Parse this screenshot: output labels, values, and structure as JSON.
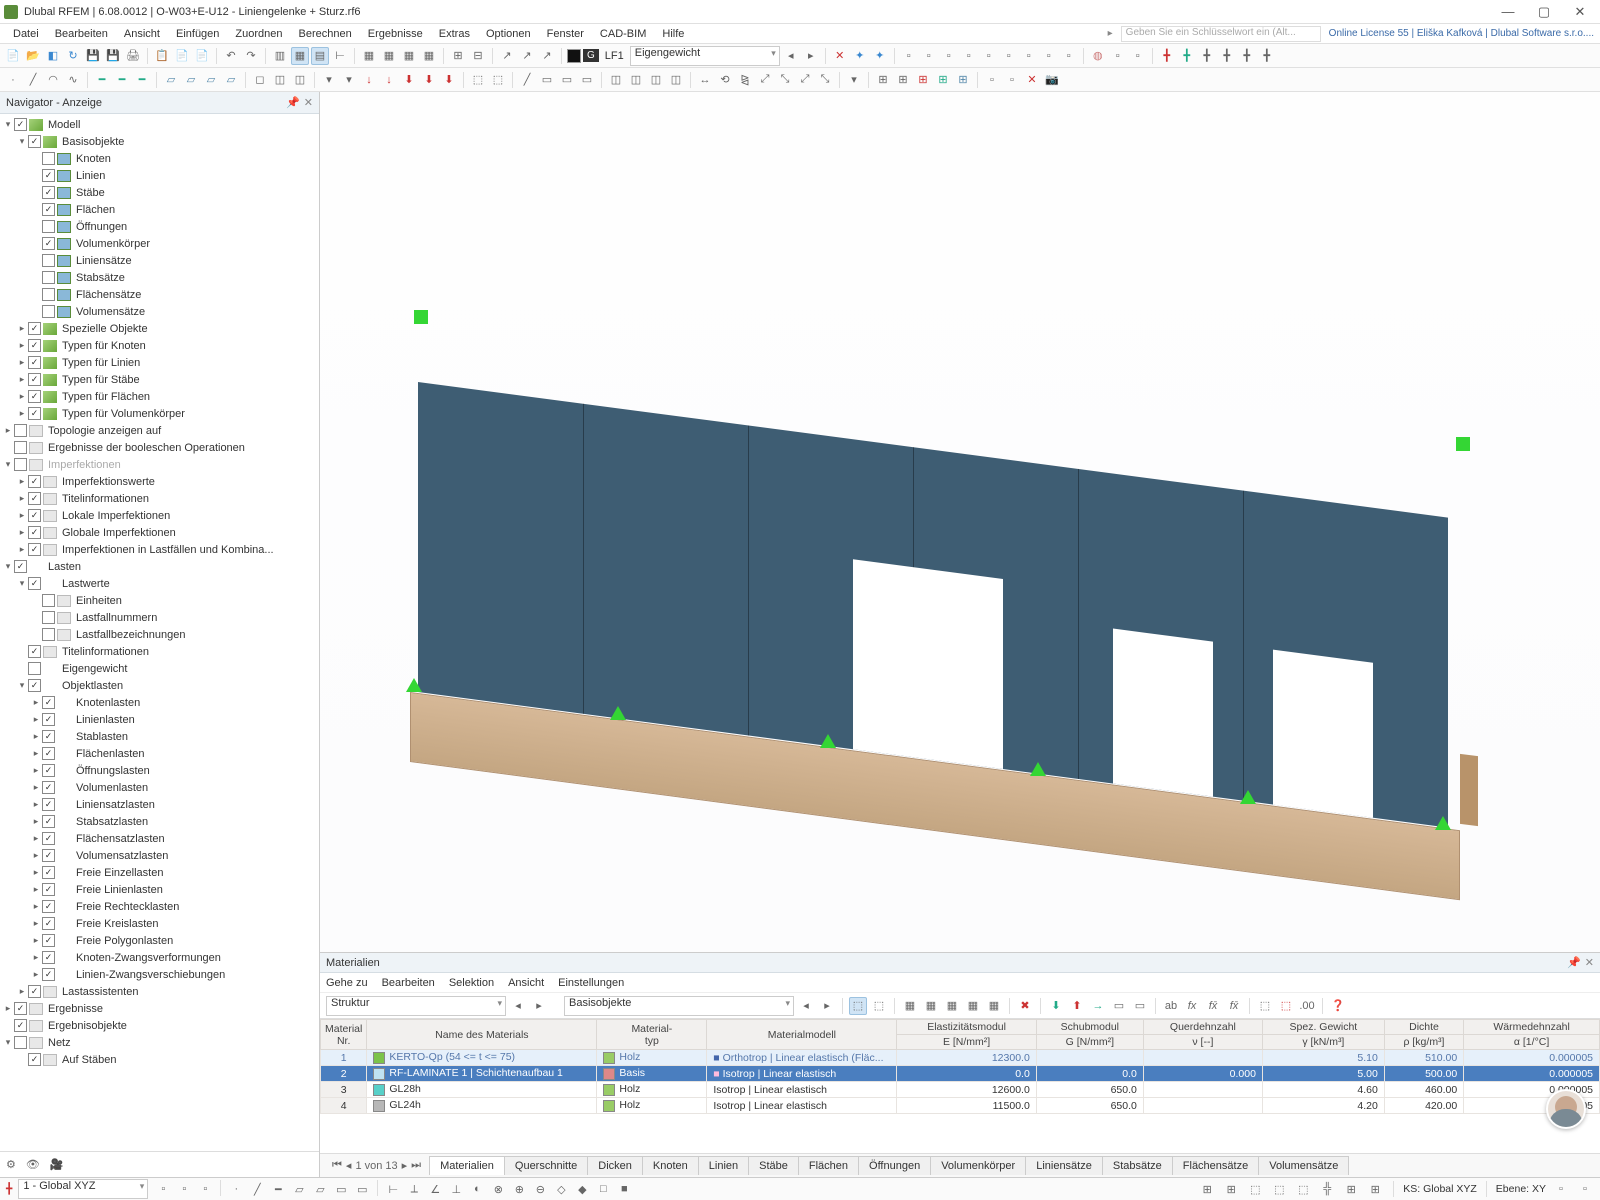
{
  "title": "Dlubal RFEM | 6.08.0012 | O-W03+E-U12 - Liniengelenke + Sturz.rf6",
  "menu": [
    "Datei",
    "Bearbeiten",
    "Ansicht",
    "Einfügen",
    "Zuordnen",
    "Berechnen",
    "Ergebnisse",
    "Extras",
    "Optionen",
    "Fenster",
    "CAD-BIM",
    "Hilfe"
  ],
  "search_ph": "Geben Sie ein Schlüsselwort ein (Alt...",
  "license": "Online License 55 | Eliška Kafková | Dlubal Software s.r.o....",
  "lf_code": "LF1",
  "lf_name": "Eigengewicht",
  "nav_title": "Navigator - Anzeige",
  "tree": {
    "model": "Modell",
    "basis": "Basisobjekte",
    "items1": [
      "Knoten",
      "Linien",
      "Stäbe",
      "Flächen",
      "Öffnungen",
      "Volumenkörper",
      "Liniensätze",
      "Stabsätze",
      "Flächensätze",
      "Volumensätze"
    ],
    "chk1": [
      false,
      true,
      true,
      true,
      false,
      true,
      false,
      false,
      false,
      false
    ],
    "spez": "Spezielle Objekte",
    "typen": [
      "Typen für Knoten",
      "Typen für Linien",
      "Typen für Stäbe",
      "Typen für Flächen",
      "Typen für Volumenkörper"
    ],
    "topo": "Topologie anzeigen auf",
    "boole": "Ergebnisse der booleschen Operationen",
    "imp": "Imperfektionen",
    "imps": [
      "Imperfektionswerte",
      "Titelinformationen",
      "Lokale Imperfektionen",
      "Globale Imperfektionen",
      "Imperfektionen in Lastfällen und Kombina..."
    ],
    "lasten": "Lasten",
    "lastwerte": "Lastwerte",
    "lv": [
      "Einheiten",
      "Lastfallnummern",
      "Lastfallbezeichnungen"
    ],
    "titel": "Titelinformationen",
    "eigen": "Eigengewicht",
    "objlast": "Objektlasten",
    "ol": [
      "Knotenlasten",
      "Linienlasten",
      "Stablasten",
      "Flächenlasten",
      "Öffnungslasten",
      "Volumenlasten",
      "Liniensatzlasten",
      "Stabsatzlasten",
      "Flächensatzlasten",
      "Volumensatzlasten",
      "Freie Einzellasten",
      "Freie Linienlasten",
      "Freie Rechtecklasten",
      "Freie Kreislasten",
      "Freie Polygonlasten",
      "Knoten-Zwangsverformungen",
      "Linien-Zwangsverschiebungen"
    ],
    "la": "Lastassistenten",
    "erg": "Ergebnisse",
    "ergobj": "Ergebnisobjekte",
    "netz": "Netz",
    "aufstab": "Auf Stäben"
  },
  "bp": {
    "title": "Materialien",
    "menu": [
      "Gehe zu",
      "Bearbeiten",
      "Selektion",
      "Ansicht",
      "Einstellungen"
    ],
    "dd1": "Struktur",
    "dd2": "Basisobjekte",
    "cols": {
      "nr1": "Material",
      "nr2": "Nr.",
      "name": "Name des Materials",
      "typ1": "Material-",
      "typ2": "typ",
      "modell": "Materialmodell",
      "e1": "Elastizitätsmodul",
      "e2": "E [N/mm²]",
      "g1": "Schubmodul",
      "g2": "G [N/mm²]",
      "v1": "Querdehnzahl",
      "v2": "ν [--]",
      "s1": "Spez. Gewicht",
      "s2": "γ [kN/m³]",
      "d1": "Dichte",
      "d2": "ρ [kg/m³]",
      "w1": "Wärmedehnzahl",
      "w2": "α [1/°C]"
    },
    "rows": [
      {
        "n": "1",
        "name": "KERTO-Qp (54 <= t <= 75)",
        "sw": "#7cc34a",
        "typ": "Holz",
        "mm": "Orthotrop | Linear elastisch (Fläc...",
        "e": "12300.0",
        "g": "",
        "v": "",
        "s": "5.10",
        "d": "510.00",
        "w": "0.000005"
      },
      {
        "n": "2",
        "name": "RF-LAMINATE 1 | Schichtenaufbau 1",
        "sw": "#bfe2f2",
        "typ": "Basis",
        "mm": "Isotrop | Linear elastisch",
        "e": "0.0",
        "g": "0.0",
        "v": "0.000",
        "s": "5.00",
        "d": "500.00",
        "w": "0.000005"
      },
      {
        "n": "3",
        "name": "GL28h",
        "sw": "#58d0c8",
        "typ": "Holz",
        "mm": "Isotrop | Linear elastisch",
        "e": "12600.0",
        "g": "650.0",
        "v": "",
        "s": "4.60",
        "d": "460.00",
        "w": "0.000005"
      },
      {
        "n": "4",
        "name": "GL24h",
        "sw": "#b7b7b7",
        "typ": "Holz",
        "mm": "Isotrop | Linear elastisch",
        "e": "11500.0",
        "g": "650.0",
        "v": "",
        "s": "4.20",
        "d": "420.00",
        "w": "0005"
      }
    ],
    "pager": "1 von 13",
    "tabs": [
      "Materialien",
      "Querschnitte",
      "Dicken",
      "Knoten",
      "Linien",
      "Stäbe",
      "Flächen",
      "Öffnungen",
      "Volumenkörper",
      "Liniensätze",
      "Stabsätze",
      "Flächensätze",
      "Volumensätze"
    ]
  },
  "status": {
    "cs": "1 - Global XYZ",
    "ks": "KS: Global XYZ",
    "ebene": "Ebene: XY"
  }
}
